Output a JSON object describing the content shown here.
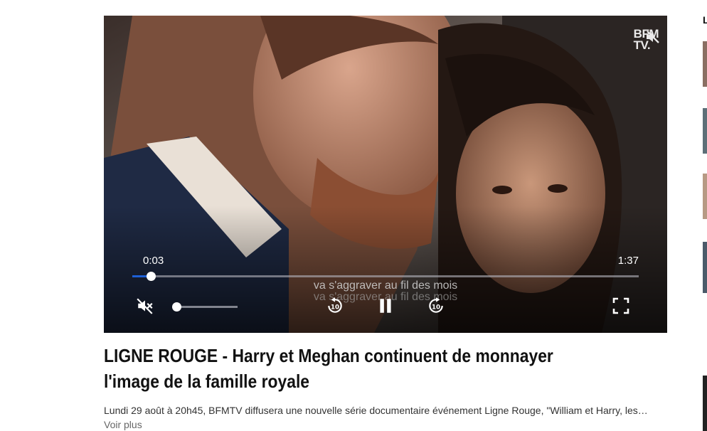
{
  "top_crumb": "⁞ ⁞ ⁞ ⁞ ⁞",
  "player": {
    "channel_logo": "BFM TV.",
    "logo_line1": "BFM",
    "logo_line2": "TV.",
    "current_time": "0:03",
    "duration": "1:37",
    "progress": 0.037,
    "volume_level": 0.0,
    "subtitle": "va s'aggraver au fil des mois",
    "icons": {
      "mute": "volume-muted-icon",
      "rewind": "rewind-10-icon",
      "pause": "pause-icon",
      "forward": "forward-10-icon",
      "fullscreen": "fullscreen-icon",
      "logo_mute": "muted-indicator-icon"
    },
    "accent_color": "#1d5fd6"
  },
  "article": {
    "title": "LIGNE ROUGE - Harry et Meghan continuent de monnayer l'image de la famille royale",
    "summary": "Lundi 29 août à 20h45, BFMTV diffusera une nouvelle série documentaire événement Ligne Rouge, \"William et Harry, les…",
    "more_label": "Voir plus"
  },
  "sidebar": {
    "heading_letter": "L"
  }
}
